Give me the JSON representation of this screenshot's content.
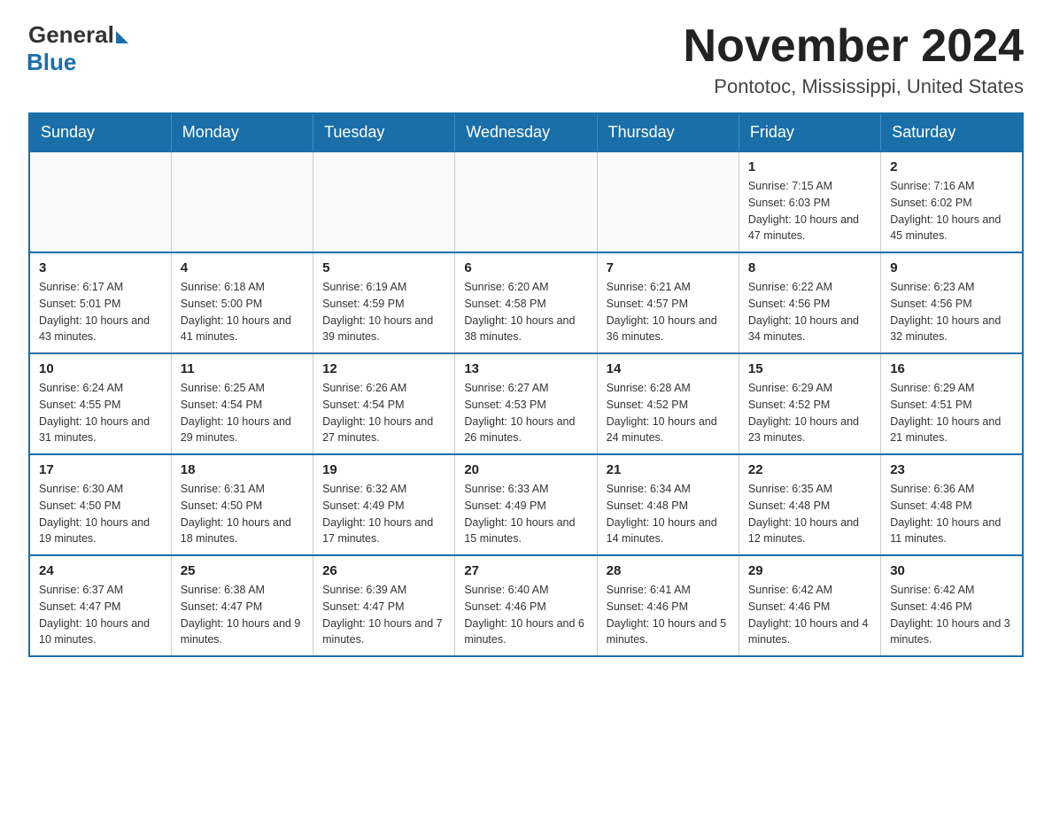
{
  "header": {
    "logo_general": "General",
    "logo_blue": "Blue",
    "month_title": "November 2024",
    "location": "Pontotoc, Mississippi, United States"
  },
  "weekdays": [
    "Sunday",
    "Monday",
    "Tuesday",
    "Wednesday",
    "Thursday",
    "Friday",
    "Saturday"
  ],
  "weeks": [
    [
      {
        "day": "",
        "info": ""
      },
      {
        "day": "",
        "info": ""
      },
      {
        "day": "",
        "info": ""
      },
      {
        "day": "",
        "info": ""
      },
      {
        "day": "",
        "info": ""
      },
      {
        "day": "1",
        "info": "Sunrise: 7:15 AM\nSunset: 6:03 PM\nDaylight: 10 hours and 47 minutes."
      },
      {
        "day": "2",
        "info": "Sunrise: 7:16 AM\nSunset: 6:02 PM\nDaylight: 10 hours and 45 minutes."
      }
    ],
    [
      {
        "day": "3",
        "info": "Sunrise: 6:17 AM\nSunset: 5:01 PM\nDaylight: 10 hours and 43 minutes."
      },
      {
        "day": "4",
        "info": "Sunrise: 6:18 AM\nSunset: 5:00 PM\nDaylight: 10 hours and 41 minutes."
      },
      {
        "day": "5",
        "info": "Sunrise: 6:19 AM\nSunset: 4:59 PM\nDaylight: 10 hours and 39 minutes."
      },
      {
        "day": "6",
        "info": "Sunrise: 6:20 AM\nSunset: 4:58 PM\nDaylight: 10 hours and 38 minutes."
      },
      {
        "day": "7",
        "info": "Sunrise: 6:21 AM\nSunset: 4:57 PM\nDaylight: 10 hours and 36 minutes."
      },
      {
        "day": "8",
        "info": "Sunrise: 6:22 AM\nSunset: 4:56 PM\nDaylight: 10 hours and 34 minutes."
      },
      {
        "day": "9",
        "info": "Sunrise: 6:23 AM\nSunset: 4:56 PM\nDaylight: 10 hours and 32 minutes."
      }
    ],
    [
      {
        "day": "10",
        "info": "Sunrise: 6:24 AM\nSunset: 4:55 PM\nDaylight: 10 hours and 31 minutes."
      },
      {
        "day": "11",
        "info": "Sunrise: 6:25 AM\nSunset: 4:54 PM\nDaylight: 10 hours and 29 minutes."
      },
      {
        "day": "12",
        "info": "Sunrise: 6:26 AM\nSunset: 4:54 PM\nDaylight: 10 hours and 27 minutes."
      },
      {
        "day": "13",
        "info": "Sunrise: 6:27 AM\nSunset: 4:53 PM\nDaylight: 10 hours and 26 minutes."
      },
      {
        "day": "14",
        "info": "Sunrise: 6:28 AM\nSunset: 4:52 PM\nDaylight: 10 hours and 24 minutes."
      },
      {
        "day": "15",
        "info": "Sunrise: 6:29 AM\nSunset: 4:52 PM\nDaylight: 10 hours and 23 minutes."
      },
      {
        "day": "16",
        "info": "Sunrise: 6:29 AM\nSunset: 4:51 PM\nDaylight: 10 hours and 21 minutes."
      }
    ],
    [
      {
        "day": "17",
        "info": "Sunrise: 6:30 AM\nSunset: 4:50 PM\nDaylight: 10 hours and 19 minutes."
      },
      {
        "day": "18",
        "info": "Sunrise: 6:31 AM\nSunset: 4:50 PM\nDaylight: 10 hours and 18 minutes."
      },
      {
        "day": "19",
        "info": "Sunrise: 6:32 AM\nSunset: 4:49 PM\nDaylight: 10 hours and 17 minutes."
      },
      {
        "day": "20",
        "info": "Sunrise: 6:33 AM\nSunset: 4:49 PM\nDaylight: 10 hours and 15 minutes."
      },
      {
        "day": "21",
        "info": "Sunrise: 6:34 AM\nSunset: 4:48 PM\nDaylight: 10 hours and 14 minutes."
      },
      {
        "day": "22",
        "info": "Sunrise: 6:35 AM\nSunset: 4:48 PM\nDaylight: 10 hours and 12 minutes."
      },
      {
        "day": "23",
        "info": "Sunrise: 6:36 AM\nSunset: 4:48 PM\nDaylight: 10 hours and 11 minutes."
      }
    ],
    [
      {
        "day": "24",
        "info": "Sunrise: 6:37 AM\nSunset: 4:47 PM\nDaylight: 10 hours and 10 minutes."
      },
      {
        "day": "25",
        "info": "Sunrise: 6:38 AM\nSunset: 4:47 PM\nDaylight: 10 hours and 9 minutes."
      },
      {
        "day": "26",
        "info": "Sunrise: 6:39 AM\nSunset: 4:47 PM\nDaylight: 10 hours and 7 minutes."
      },
      {
        "day": "27",
        "info": "Sunrise: 6:40 AM\nSunset: 4:46 PM\nDaylight: 10 hours and 6 minutes."
      },
      {
        "day": "28",
        "info": "Sunrise: 6:41 AM\nSunset: 4:46 PM\nDaylight: 10 hours and 5 minutes."
      },
      {
        "day": "29",
        "info": "Sunrise: 6:42 AM\nSunset: 4:46 PM\nDaylight: 10 hours and 4 minutes."
      },
      {
        "day": "30",
        "info": "Sunrise: 6:42 AM\nSunset: 4:46 PM\nDaylight: 10 hours and 3 minutes."
      }
    ]
  ]
}
